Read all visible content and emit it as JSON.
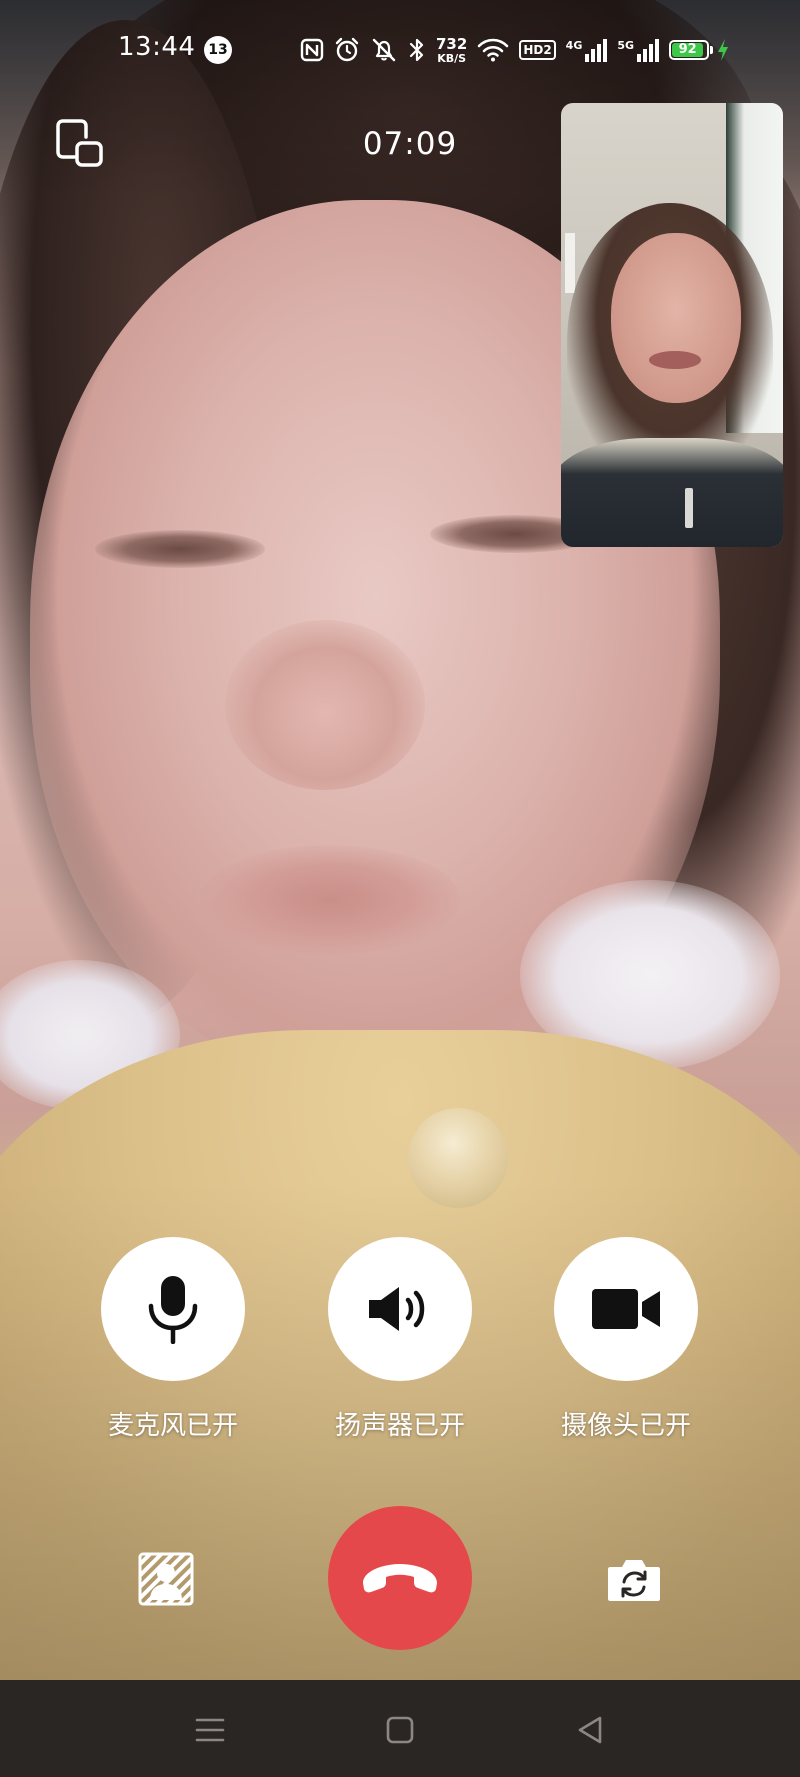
{
  "status_bar": {
    "time": "13:44",
    "notification_count": "13",
    "icons": [
      "nfc-icon",
      "alarm-icon",
      "mute-icon",
      "bluetooth-icon"
    ],
    "net_speed_value": "732",
    "net_speed_unit": "KB/S",
    "hd_label": "HD2",
    "sim1_label": "4G",
    "sim2_label": "5G",
    "battery_level": "92",
    "battery_charging": true,
    "battery_color": "#3ec84a"
  },
  "call": {
    "timer": "07:09",
    "switch_window_icon": "switch-window-icon"
  },
  "controls": {
    "mic_label": "麦克风已开",
    "speaker_label": "扬声器已开",
    "camera_label": "摄像头已开"
  },
  "actions": {
    "background_icon": "background-blur-icon",
    "hangup_icon": "hangup-icon",
    "hangup_color": "#e5484a",
    "flip_camera_icon": "flip-camera-icon"
  },
  "nav": {
    "items": [
      "menu-icon",
      "home-icon",
      "back-icon"
    ]
  }
}
